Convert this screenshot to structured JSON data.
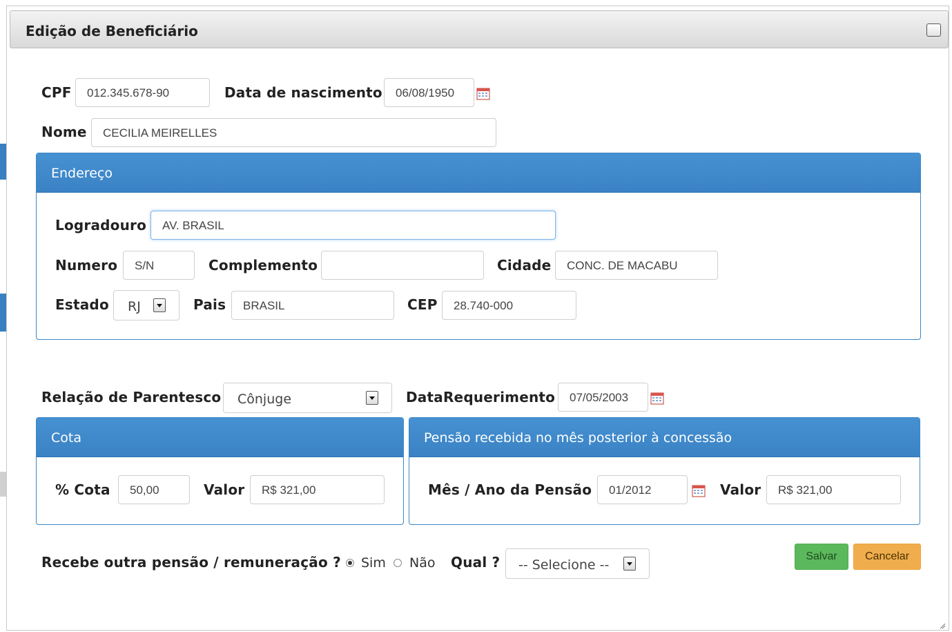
{
  "dialog": {
    "title": "Edição de Beneficiário"
  },
  "person": {
    "cpf_label": "CPF",
    "cpf_value": "012.345.678-90",
    "birth_label": "Data de nascimento",
    "birth_value": "06/08/1950",
    "name_label": "Nome",
    "name_value": "CECILIA MEIRELLES"
  },
  "address": {
    "panel_title": "Endereço",
    "street_label": "Logradouro",
    "street_value": "AV. BRASIL",
    "number_label": "Numero",
    "number_value": "S/N",
    "complement_label": "Complemento",
    "complement_value": "",
    "city_label": "Cidade",
    "city_value": "CONC. DE MACABU",
    "state_label": "Estado",
    "state_value": "RJ",
    "country_label": "Pais",
    "country_value": "BRASIL",
    "zip_label": "CEP",
    "zip_value": "28.740-000"
  },
  "relation": {
    "label": "Relação de Parentesco",
    "value": "Cônjuge",
    "request_date_label": "DataRequerimento",
    "request_date_value": "07/05/2003"
  },
  "quota": {
    "panel_title": "Cota",
    "pct_label": "% Cota",
    "pct_value": "50,00",
    "value_label": "Valor",
    "value_value": "R$ 321,00"
  },
  "pension": {
    "panel_title": "Pensão recebida no mês posterior à concessão",
    "month_label": "Mês / Ano da Pensão",
    "month_value": "01/2012",
    "value_label": "Valor",
    "value_value": "R$ 321,00"
  },
  "other": {
    "question_label": "Recebe outra pensão / remuneração ?",
    "yes_label": "Sim",
    "no_label": "Não",
    "selected": "Sim",
    "which_label": "Qual ?",
    "which_value": "-- Selecione --"
  },
  "actions": {
    "save_label": "Salvar",
    "cancel_label": "Cancelar"
  },
  "colors": {
    "panel_header": "#3d88c9",
    "save": "#5cb85c",
    "cancel": "#f0ad4e"
  }
}
